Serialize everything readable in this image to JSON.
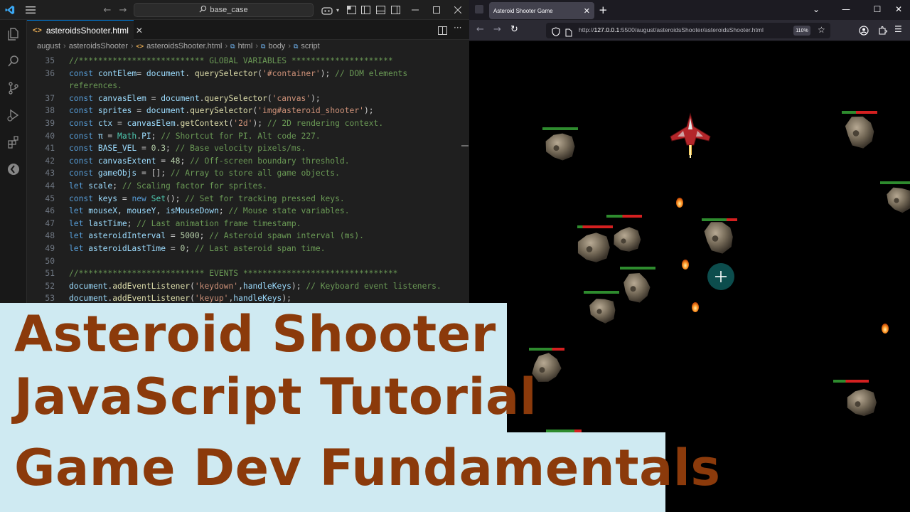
{
  "vscode": {
    "search_text": "base_case",
    "tab": {
      "label": "asteroidsShooter.html"
    },
    "breadcrumb": [
      "august",
      "asteroidsShooter",
      "asteroidsShooter.html",
      "html",
      "body",
      "script"
    ],
    "code_lines": [
      {
        "n": "35",
        "parts": [
          [
            "cm",
            "//************************** GLOBAL VARIABLES *********************"
          ]
        ]
      },
      {
        "n": "36",
        "parts": [
          [
            "kw",
            "const "
          ],
          [
            "id",
            "contElem"
          ],
          [
            "",
            "="
          ],
          [
            "id",
            " document"
          ],
          [
            "",
            ". "
          ],
          [
            "fn",
            "querySelector"
          ],
          [
            "",
            "("
          ],
          [
            "str",
            "'#container'"
          ],
          [
            "",
            ");"
          ],
          [
            "cm",
            " // DOM elements"
          ]
        ]
      },
      {
        "n": "",
        "parts": [
          [
            "cm",
            "references."
          ]
        ]
      },
      {
        "n": "37",
        "parts": [
          [
            "kw",
            "const "
          ],
          [
            "id",
            "canvasElem"
          ],
          [
            "",
            " = "
          ],
          [
            "id",
            "document"
          ],
          [
            "",
            "."
          ],
          [
            "fn",
            "querySelector"
          ],
          [
            "",
            "("
          ],
          [
            "str",
            "'canvas'"
          ],
          [
            "",
            ");"
          ]
        ]
      },
      {
        "n": "38",
        "parts": [
          [
            "kw",
            "const "
          ],
          [
            "id",
            "sprites"
          ],
          [
            "",
            " = "
          ],
          [
            "id",
            "document"
          ],
          [
            "",
            "."
          ],
          [
            "fn",
            "querySelector"
          ],
          [
            "",
            "("
          ],
          [
            "str",
            "'img#asteroid_shooter'"
          ],
          [
            "",
            ");"
          ]
        ]
      },
      {
        "n": "39",
        "parts": [
          [
            "kw",
            "const "
          ],
          [
            "id",
            "ctx"
          ],
          [
            "",
            " = "
          ],
          [
            "id",
            "canvasElem"
          ],
          [
            "",
            "."
          ],
          [
            "fn",
            "getContext"
          ],
          [
            "",
            "("
          ],
          [
            "str",
            "'2d'"
          ],
          [
            "",
            ");"
          ],
          [
            "cm",
            " // 2D rendering context."
          ]
        ]
      },
      {
        "n": "40",
        "parts": [
          [
            "kw",
            "const "
          ],
          [
            "id",
            "π"
          ],
          [
            "",
            " = "
          ],
          [
            "cls",
            "Math"
          ],
          [
            "",
            "."
          ],
          [
            "id",
            "PI"
          ],
          [
            "",
            ";"
          ],
          [
            "cm",
            " // Shortcut for PI. Alt code 227."
          ]
        ]
      },
      {
        "n": "41",
        "parts": [
          [
            "kw",
            "const "
          ],
          [
            "id",
            "BASE_VEL"
          ],
          [
            "",
            " = "
          ],
          [
            "num",
            "0.3"
          ],
          [
            "",
            ";"
          ],
          [
            "cm",
            " // Base velocity pixels/ms."
          ]
        ]
      },
      {
        "n": "42",
        "parts": [
          [
            "kw",
            "const "
          ],
          [
            "id",
            "canvasExtent"
          ],
          [
            "",
            " = "
          ],
          [
            "num",
            "48"
          ],
          [
            "",
            ";"
          ],
          [
            "cm",
            " // Off-screen boundary threshold."
          ]
        ]
      },
      {
        "n": "43",
        "parts": [
          [
            "kw",
            "const "
          ],
          [
            "id",
            "gameObjs"
          ],
          [
            "",
            " = [];"
          ],
          [
            "cm",
            " // Array to store all game objects."
          ]
        ]
      },
      {
        "n": "44",
        "parts": [
          [
            "kw",
            "let "
          ],
          [
            "id",
            "scale"
          ],
          [
            "",
            ";"
          ],
          [
            "cm",
            " // Scaling factor for sprites."
          ]
        ]
      },
      {
        "n": "45",
        "parts": [
          [
            "kw",
            "const "
          ],
          [
            "id",
            "keys"
          ],
          [
            "",
            " = "
          ],
          [
            "kw",
            "new "
          ],
          [
            "cls",
            "Set"
          ],
          [
            "",
            "();"
          ],
          [
            "cm",
            " // Set for tracking pressed keys."
          ]
        ]
      },
      {
        "n": "46",
        "parts": [
          [
            "kw",
            "let "
          ],
          [
            "id",
            "mouseX"
          ],
          [
            "",
            ", "
          ],
          [
            "id",
            "mouseY"
          ],
          [
            "",
            ", "
          ],
          [
            "id",
            "isMouseDown"
          ],
          [
            "",
            ";"
          ],
          [
            "cm",
            " // Mouse state variables."
          ]
        ]
      },
      {
        "n": "47",
        "parts": [
          [
            "kw",
            "let "
          ],
          [
            "id",
            "lastTime"
          ],
          [
            "",
            ";"
          ],
          [
            "cm",
            " // Last animation frame timestamp."
          ]
        ]
      },
      {
        "n": "48",
        "parts": [
          [
            "kw",
            "let "
          ],
          [
            "id",
            "asteroidInterval"
          ],
          [
            "",
            " = "
          ],
          [
            "num",
            "5000"
          ],
          [
            "",
            ";"
          ],
          [
            "cm",
            " // Asteroid spawn interval (ms)."
          ]
        ]
      },
      {
        "n": "49",
        "parts": [
          [
            "kw",
            "let "
          ],
          [
            "id",
            "asteroidLastTime"
          ],
          [
            "",
            " = "
          ],
          [
            "num",
            "0"
          ],
          [
            "",
            ";"
          ],
          [
            "cm",
            " // Last asteroid span time."
          ]
        ]
      },
      {
        "n": "50",
        "parts": []
      },
      {
        "n": "51",
        "parts": [
          [
            "cm",
            "//************************** EVENTS ********************************"
          ]
        ]
      },
      {
        "n": "52",
        "parts": [
          [
            "id",
            "document"
          ],
          [
            "",
            "."
          ],
          [
            "fn",
            "addEventListener"
          ],
          [
            "",
            "("
          ],
          [
            "str",
            "'keydown'"
          ],
          [
            "",
            ","
          ],
          [
            "id",
            "handleKeys"
          ],
          [
            "",
            ");"
          ],
          [
            "cm",
            " // Keyboard event listeners."
          ]
        ]
      },
      {
        "n": "53",
        "parts": [
          [
            "id",
            "document"
          ],
          [
            "",
            "."
          ],
          [
            "fn",
            "addEventListener"
          ],
          [
            "",
            "("
          ],
          [
            "str",
            "'keyup'"
          ],
          [
            "",
            ","
          ],
          [
            "id",
            "handleKeys"
          ],
          [
            "",
            ");"
          ]
        ]
      }
    ]
  },
  "browser": {
    "tab_title": "Asteroid Shooter Game",
    "url_prefix": "http://",
    "url_host": "127.0.0.1",
    "url_rest": ":5500/august/asteroidsShooter/asteroidsShooter.html",
    "zoom": "110%"
  },
  "overlay": {
    "line1": "Asteroid Shooter",
    "line2": "JavaScript Tutorial",
    "line3": "Game Dev Fundamentals"
  },
  "colors": {
    "title_text": "#8b3a0b",
    "overlay_bg": "#cfeaf2",
    "health_green": "#2e8b2e",
    "health_red": "#d42020"
  }
}
